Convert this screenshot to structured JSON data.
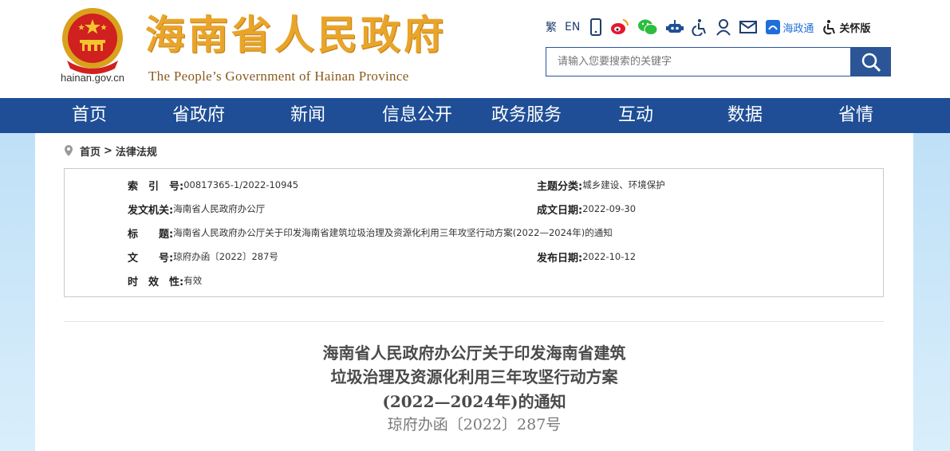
{
  "header": {
    "domain": "hainan.gov.cn",
    "title": "海南省人民政府",
    "subtitle": "The People’s Government  of Hainan Province",
    "toolbar": {
      "traditional": "繁",
      "english": "EN",
      "haizhengtong": "海政通",
      "care_mode": "关怀版",
      "icons": [
        "mobile-icon",
        "weibo-icon",
        "wechat-icon",
        "robot-icon",
        "accessibility-icon",
        "user-icon",
        "mail-icon",
        "haizhengtong-icon",
        "care-mode-icon"
      ]
    },
    "search": {
      "placeholder": "请输入您要搜索的关键字"
    }
  },
  "nav": {
    "items": [
      {
        "label": "首页"
      },
      {
        "label": "省政府"
      },
      {
        "label": "新闻"
      },
      {
        "label": "信息公开"
      },
      {
        "label": "政务服务"
      },
      {
        "label": "互动"
      },
      {
        "label": "数据"
      },
      {
        "label": "省情"
      }
    ]
  },
  "breadcrumb": {
    "home": "首页",
    "separator": ">",
    "current": "法律法规"
  },
  "meta": {
    "index_label": "索　引　号:",
    "index_value": "00817365-1/2022-10945",
    "category_label": "主题分类:",
    "category_value": "城乡建设、环境保护",
    "issuer_label": "发文机关:",
    "issuer_value": "海南省人民政府办公厅",
    "created_label": "成文日期:",
    "created_value": "2022-09-30",
    "title_label": "标　　题:",
    "title_value": "海南省人民政府办公厅关于印发海南省建筑垃圾治理及资源化利用三年攻坚行动方案(2022—2024年)的通知",
    "docno_label": "文　　号:",
    "docno_value": "琼府办函〔2022〕287号",
    "published_label": "发布日期:",
    "published_value": "2022-10-12",
    "validity_label": "时　效　性:",
    "validity_value": "有效"
  },
  "document": {
    "title_lines": [
      "海南省人民政府办公厅关于印发海南省建筑",
      "垃圾治理及资源化利用三年攻坚行动方案",
      "(2022—2024年)的通知"
    ],
    "number": "琼府办函〔2022〕287号"
  },
  "colors": {
    "nav_bg": "#1f4e96",
    "title_gold": "#e9a52a",
    "side_bg": "#bfe0f7"
  }
}
